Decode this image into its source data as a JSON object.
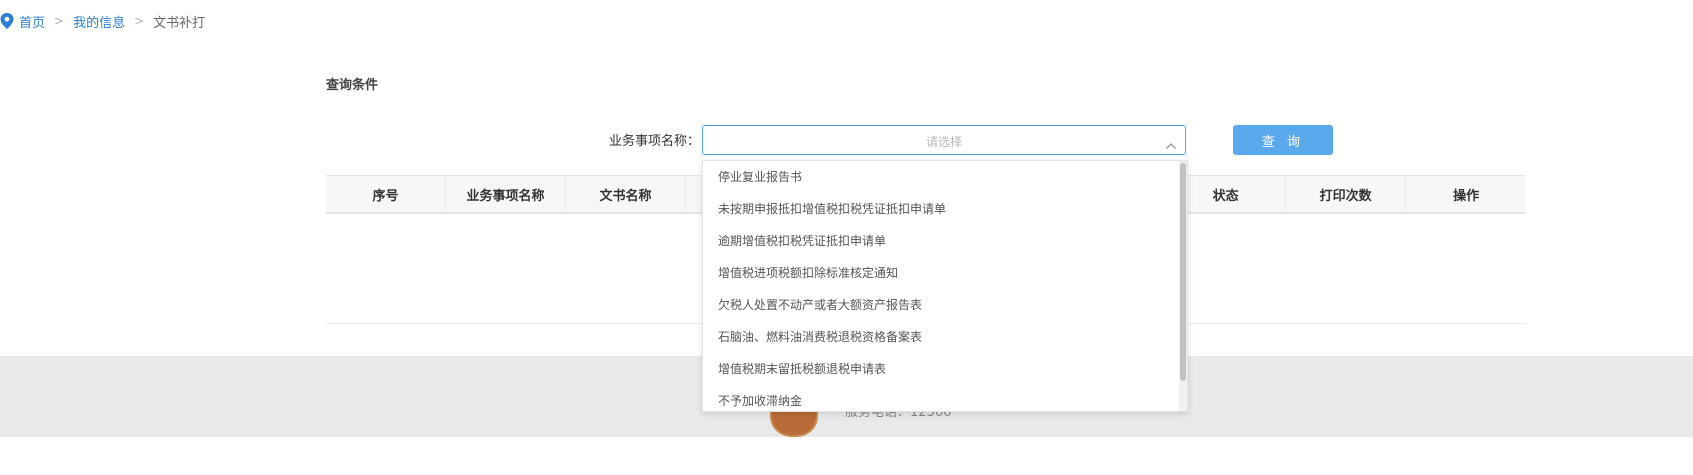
{
  "breadcrumb": {
    "icon": "location-pin-icon",
    "home": "首页",
    "my_info": "我的信息",
    "current": "文书补打",
    "separator": ">"
  },
  "query": {
    "section_title": "查询条件",
    "field_label": "业务事项名称：",
    "placeholder": "请选择",
    "button_label": "查 询"
  },
  "table": {
    "headers": [
      "序号",
      "业务事项名称",
      "文书名称",
      "",
      "",
      "",
      "",
      "状态",
      "打印次数",
      "操作"
    ]
  },
  "dropdown": {
    "options": [
      "停业复业报告书",
      "未按期申报抵扣增值税扣税凭证抵扣申请单",
      "逾期增值税扣税凭证抵扣申请单",
      "增值税进项税额扣除标准核定通知",
      "欠税人处置不动产或者大额资产报告表",
      "石脑油、燃料油消费税退税资格备案表",
      "增值税期末留抵税额退税申请表",
      "不予加收滞纳金"
    ]
  },
  "footer": {
    "text": "服务电话：12366"
  },
  "colors": {
    "link": "#2a7fd4",
    "accent": "#5aa9ec",
    "footer_bg": "#e9e9eb"
  }
}
